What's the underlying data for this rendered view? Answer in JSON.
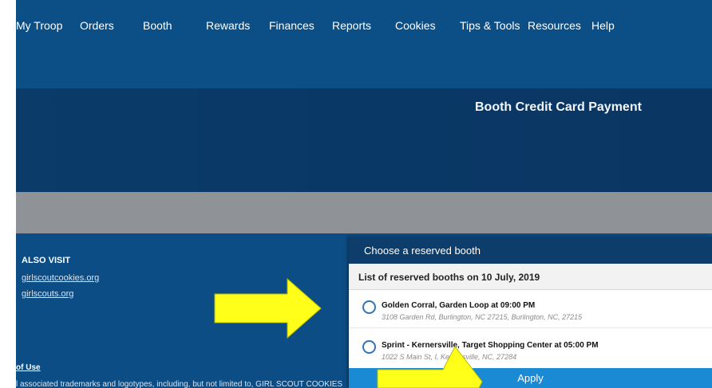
{
  "nav": {
    "items": [
      {
        "label": "My Troop"
      },
      {
        "label": "Orders"
      },
      {
        "label": "Booth"
      },
      {
        "label": "Rewards"
      },
      {
        "label": "Finances"
      },
      {
        "label": "Reports"
      },
      {
        "label": "Cookies"
      },
      {
        "label": "Tips & Tools"
      },
      {
        "label": "Resources"
      },
      {
        "label": "Help"
      }
    ]
  },
  "banner": {
    "title": "Booth Credit Card Payment"
  },
  "footer": {
    "also_visit": "ALSO VISIT",
    "links": [
      {
        "label": "girlscoutcookies.org"
      },
      {
        "label": "girlscouts.org"
      }
    ],
    "terms": "of Use",
    "legal": "l associated trademarks and logotypes, including, but not limited to, GIRL SCOUT COOKIES"
  },
  "dialog": {
    "title": "Choose a reserved booth",
    "subtitle": "List of reserved booths on 10 July, 2019",
    "booths": [
      {
        "name": "Golden Corral, Garden Loop at 09:00 PM",
        "address": "3108 Garden Rd, Burlington, NC 27215, Burlington, NC, 27215"
      },
      {
        "name": "Sprint - Kernersville, Target Shopping Center at 05:00 PM",
        "address": "1022 S Main St, I, Kernersville, NC, 27284"
      }
    ],
    "apply_label": "Apply"
  },
  "colors": {
    "nav_bg": "#0b4f86",
    "banner_bg": "#0a3966",
    "dialog_header": "#0c3d6b",
    "apply_bg": "#1a8ad4",
    "arrow_fill": "#ffff1a",
    "grey_band": "#8f9397"
  },
  "icons": [
    "radio-unchecked-icon",
    "right-arrow-annotation-icon",
    "up-arrow-annotation-icon"
  ]
}
